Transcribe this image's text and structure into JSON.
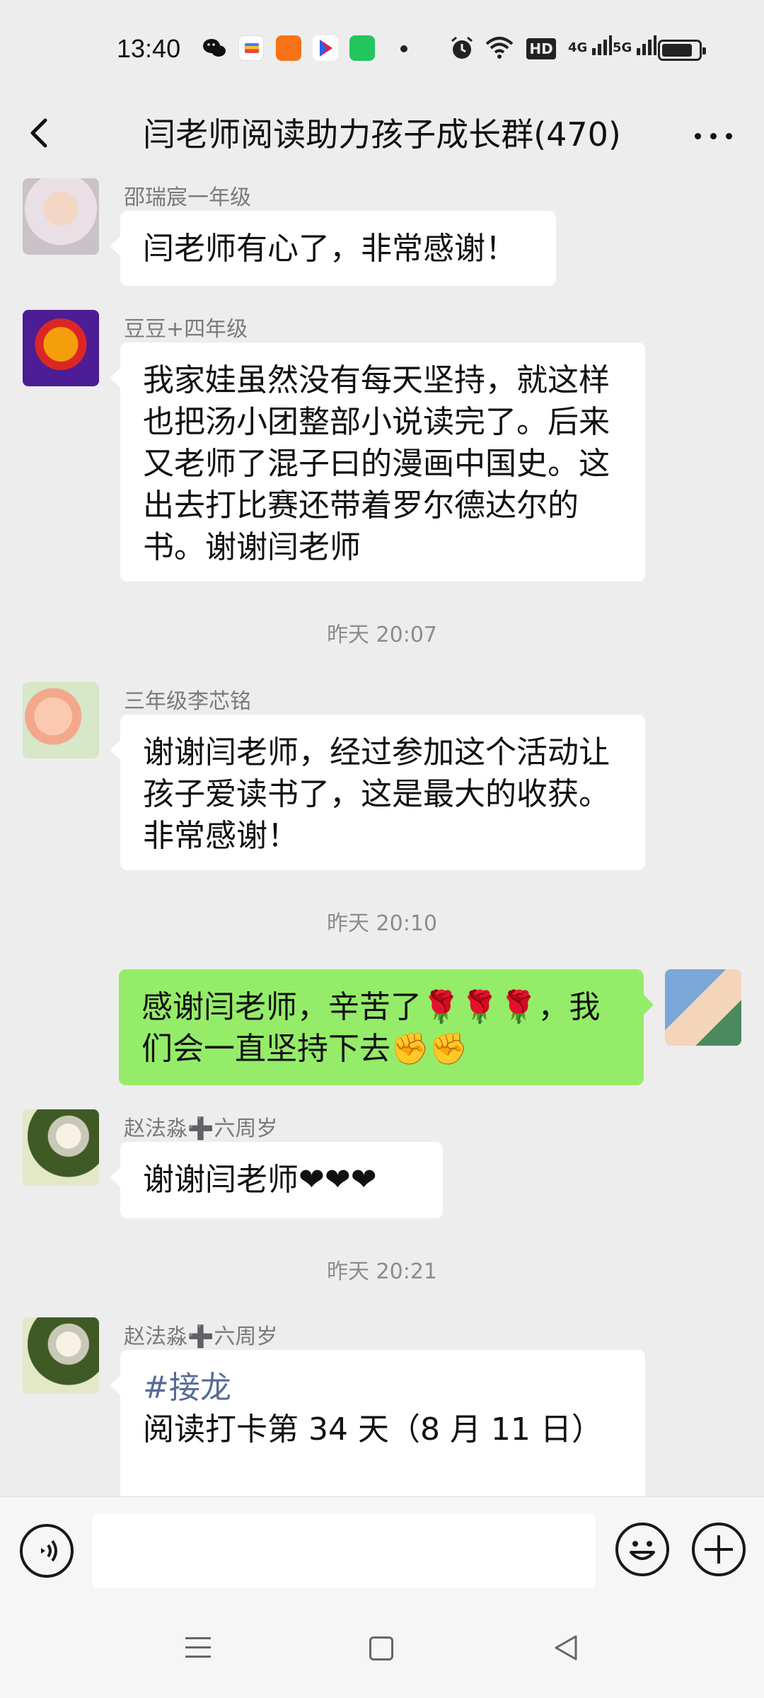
{
  "status_bar": {
    "time": "13:40",
    "network_labels": [
      "HD",
      "4G",
      "5G"
    ]
  },
  "header": {
    "title": "闫老师阅读助力孩子成长群(470)",
    "back_icon": "chevron-left-icon",
    "more_icon": "more-dots-icon"
  },
  "messages": [
    {
      "sender": "邵瑞宸一年级",
      "text": "闫老师有心了，非常感谢！"
    },
    {
      "sender": "豆豆+四年级",
      "text": "我家娃虽然没有每天坚持，就这样也把汤小团整部小说读完了。后来又老师了混子曰的漫画中国史。这出去打比赛还带着罗尔德达尔的书。谢谢闫老师"
    },
    {
      "timestamp": "昨天 20:07"
    },
    {
      "sender": "三年级李芯铭",
      "text": "谢谢闫老师，经过参加这个活动让孩子爱读书了，这是最大的收获。非常感谢！"
    },
    {
      "timestamp": "昨天 20:10"
    },
    {
      "sender": "me",
      "text": "感谢闫老师，辛苦了🌹🌹🌹，我们会一直坚持下去✊✊"
    },
    {
      "sender": "赵法淼➕六周岁",
      "text": "谢谢闫老师❤❤❤"
    },
    {
      "timestamp": "昨天 20:21"
    },
    {
      "sender": "赵法淼➕六周岁",
      "hashtag": "#接龙",
      "text": "阅读打卡第 34 天（8 月 11 日）"
    }
  ],
  "input_bar": {
    "voice_icon": "voice-icon",
    "emoji_icon": "emoji-icon",
    "plus_icon": "plus-icon",
    "placeholder": ""
  },
  "nav_bar": {
    "icons": [
      "menu-icon",
      "home-icon",
      "back-triangle-icon"
    ]
  }
}
